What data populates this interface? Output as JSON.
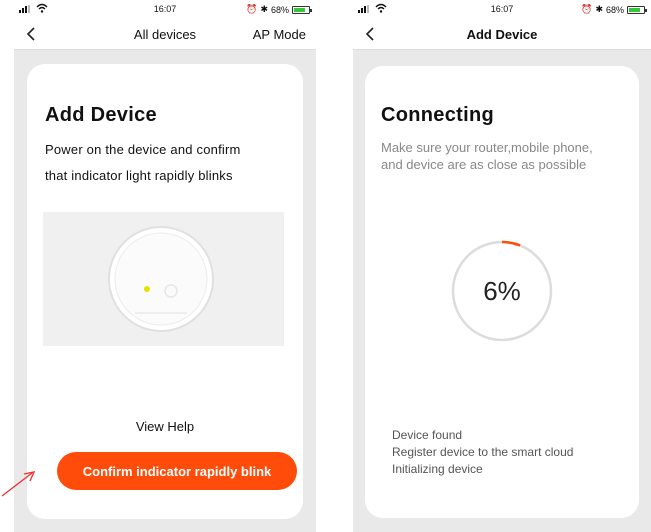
{
  "left_screen": {
    "status": {
      "time": "16:07",
      "battery": "68%"
    },
    "nav": {
      "title": "All devices",
      "action": "AP Mode"
    },
    "card": {
      "title": "Add Device",
      "instruction_line1": "Power on the device and confirm",
      "instruction_line2": "that indicator light rapidly blinks",
      "view_help": "View Help",
      "confirm_label": "Confirm indicator rapidly blink"
    }
  },
  "right_screen": {
    "status": {
      "time": "16:07",
      "battery": "68%"
    },
    "nav": {
      "title": "Add Device"
    },
    "card": {
      "title": "Connecting",
      "hint_line1": "Make sure your router,mobile phone,",
      "hint_line2": "and device are as close as possible",
      "progress_label": "6%",
      "progress_value": 0.06,
      "steps": [
        "Device found",
        "Register device to the smart cloud",
        "Initializing device"
      ]
    }
  },
  "colors": {
    "accent": "#ff4c0a",
    "indicator_light": "#e8e000",
    "battery_fill": "#35c93a"
  },
  "icons": [
    "signal-icon",
    "wifi-icon",
    "alarm-icon",
    "bluetooth-icon",
    "battery-icon",
    "back-chevron-icon",
    "red-arrow-icon"
  ]
}
